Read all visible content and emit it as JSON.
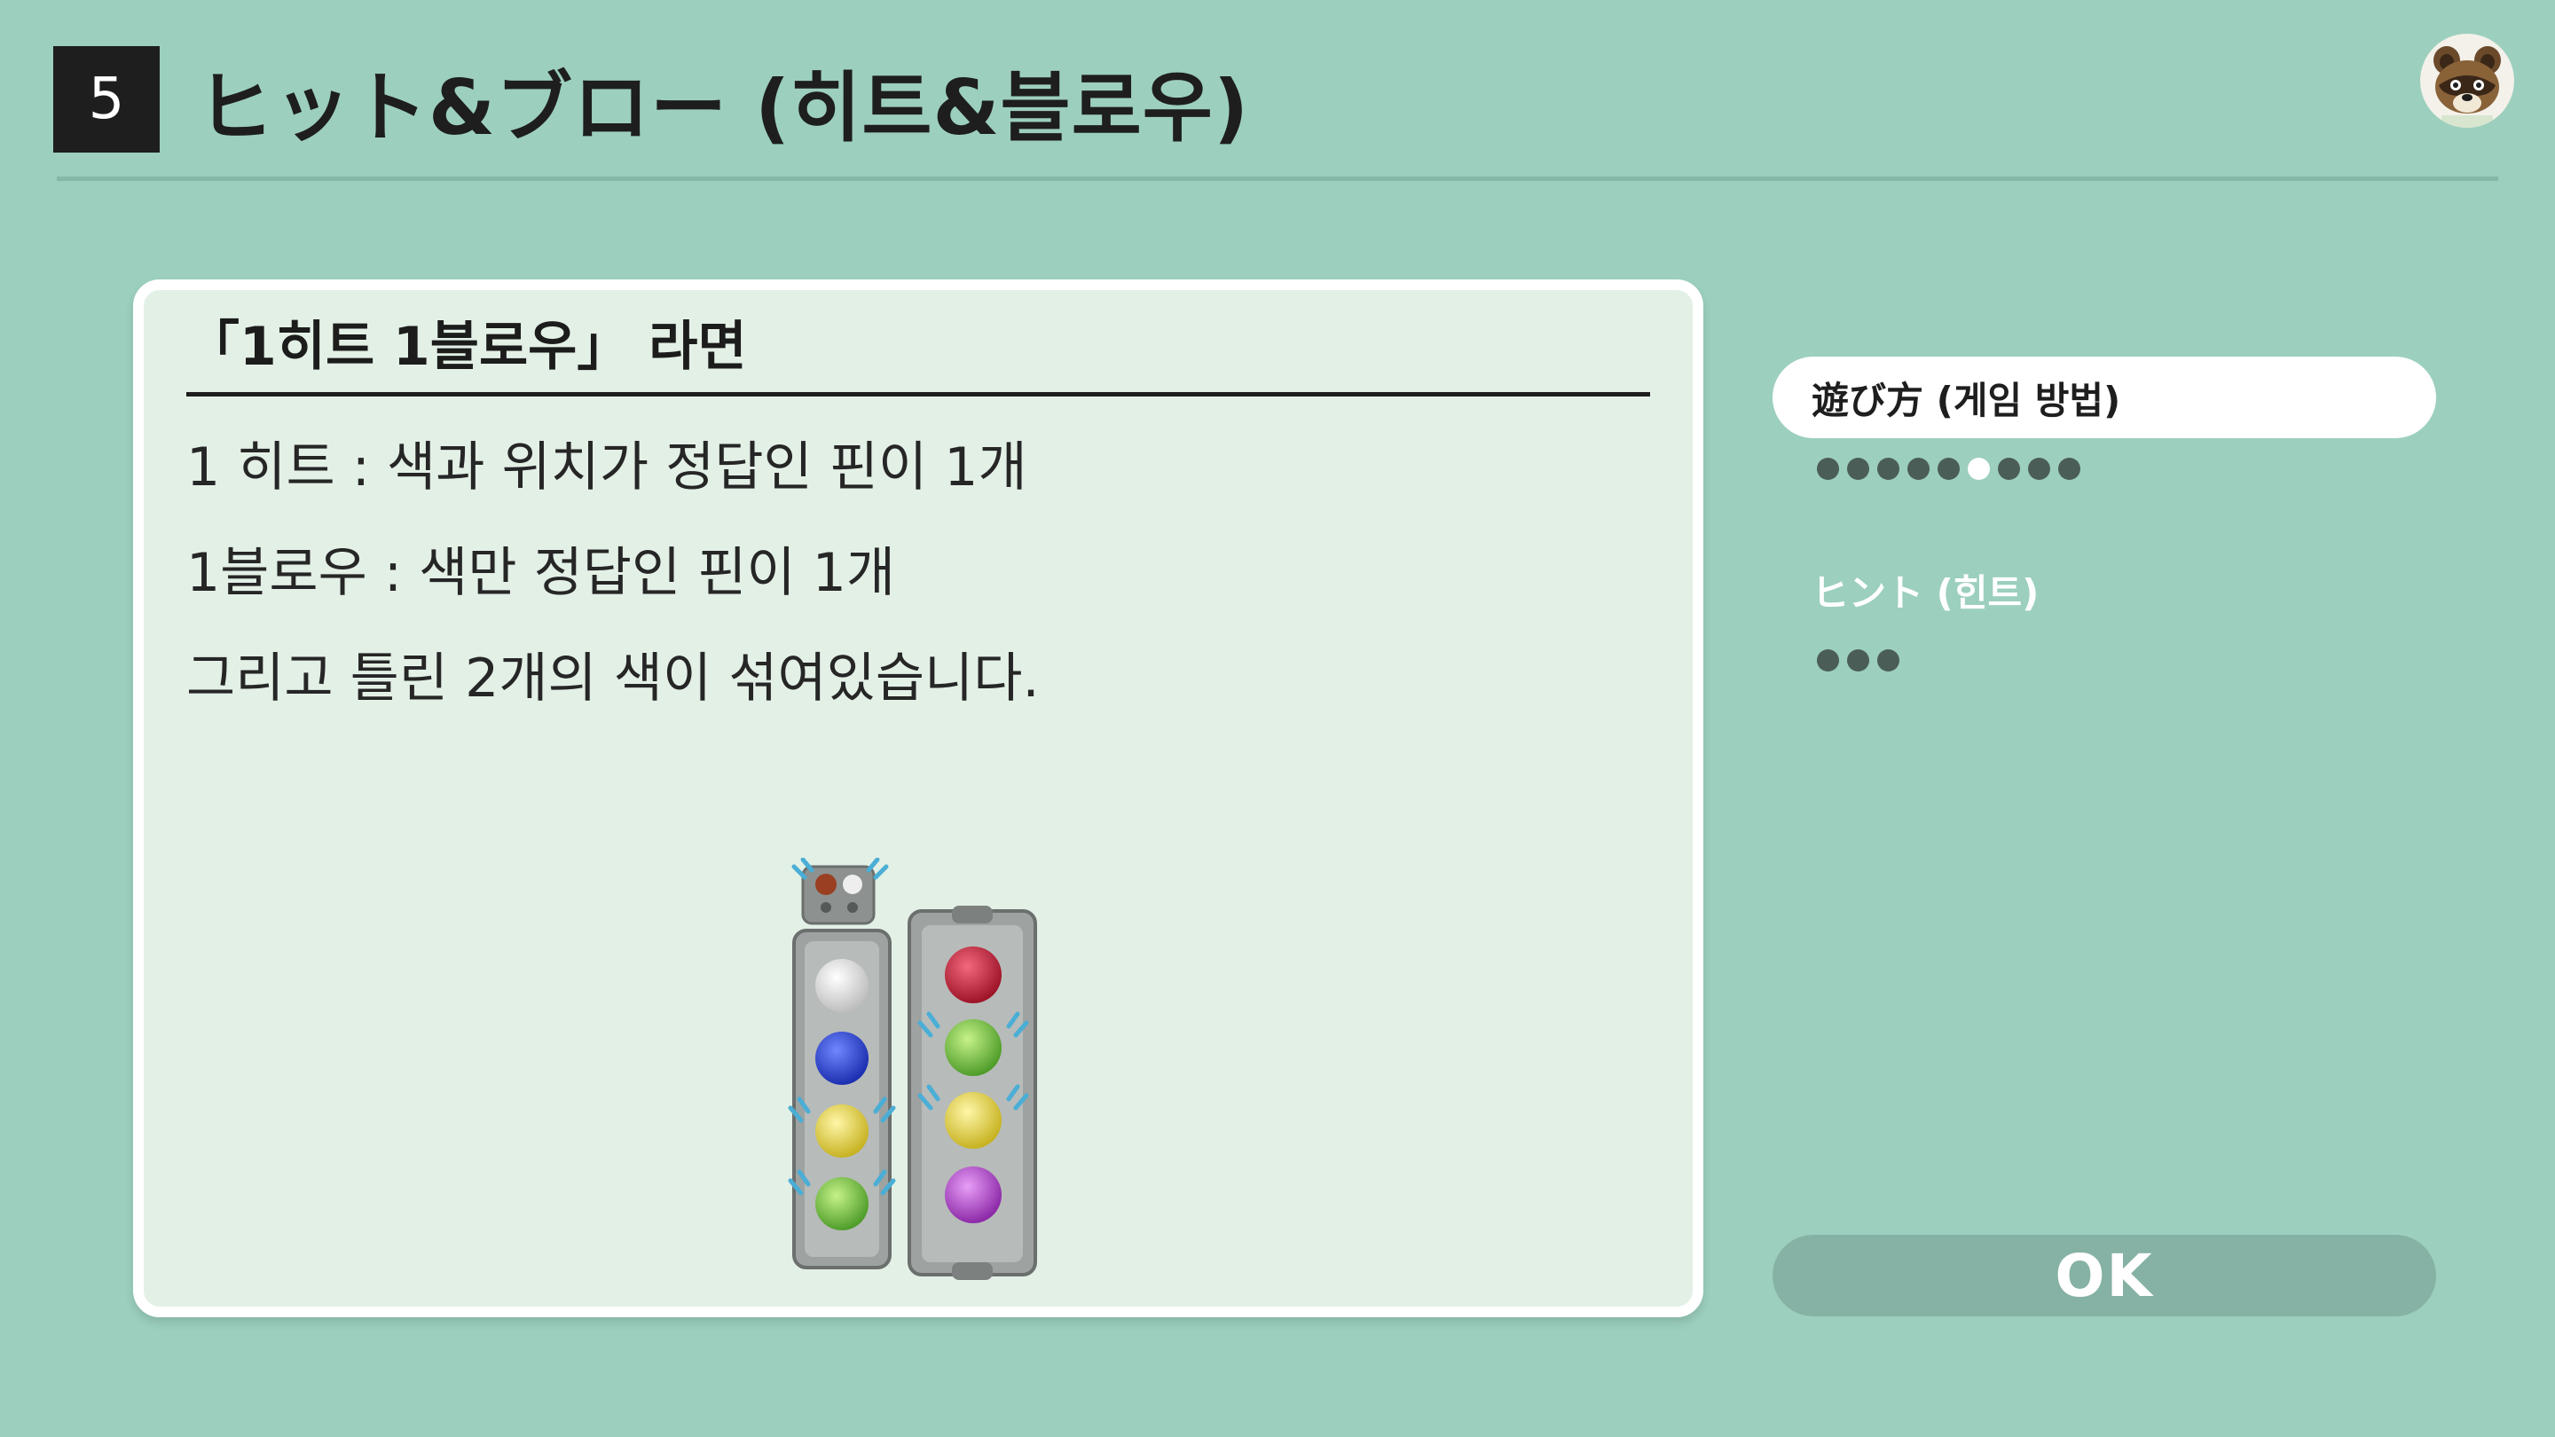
{
  "header": {
    "number": "5",
    "title": "ヒット&ブロー (히트&블로우)"
  },
  "panel": {
    "heading": "「1히트 1블로우」 라면",
    "lines": [
      "1 히트 : 색과 위치가 정답인 핀이 1개",
      "1블로우 : 색만 정답인 핀이 1개",
      "그리고 틀린 2개의 색이 섞여있습니다."
    ]
  },
  "illustration": {
    "indicator_pegs": [
      "red",
      "white"
    ],
    "guess_pegs": [
      "white",
      "blue",
      "yellow",
      "green"
    ],
    "answer_pegs": [
      "red",
      "green",
      "yellow",
      "purple"
    ]
  },
  "sidebar": {
    "howto": {
      "label": "遊び方 (게임 방법)",
      "pages": 9,
      "current_page": 6
    },
    "hint": {
      "label": "ヒント (힌트)",
      "pages": 3
    }
  },
  "ok_button": {
    "label": "OK"
  },
  "colors": {
    "background": "#9ccfbe",
    "panel": "#e3f0e6",
    "dark": "#1e1e1e",
    "dot": "#4b5d57",
    "ok": "#85b2a4"
  },
  "icons": {
    "avatar": "tom-nook-avatar-icon"
  }
}
